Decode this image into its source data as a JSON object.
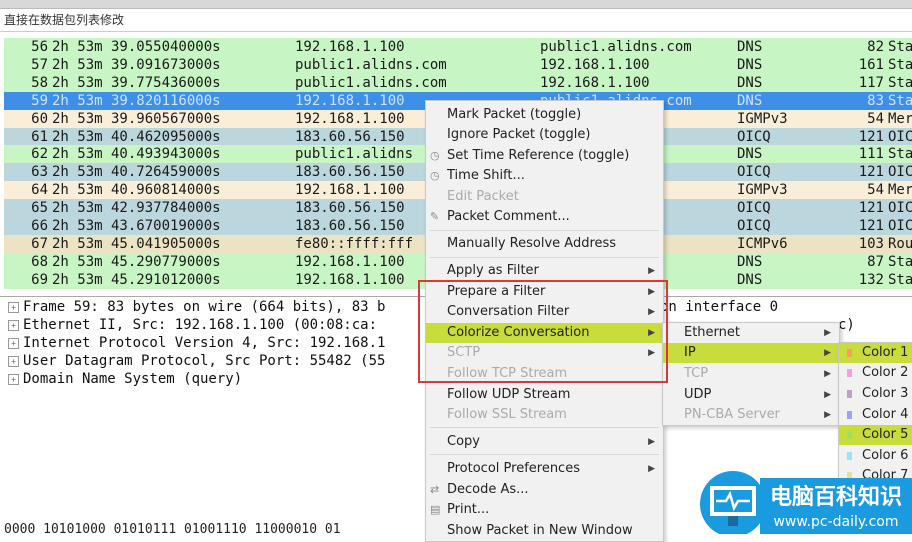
{
  "filter_bar": {
    "text": "直接在数据包列表修改"
  },
  "packets": [
    {
      "no": "56",
      "time": "2h 53m 39.055040000s",
      "src": "192.168.1.100",
      "dst": "public1.alidns.com",
      "proto": "DNS",
      "len": "82",
      "info": "Sta",
      "color": "#c8f5c4"
    },
    {
      "no": "57",
      "time": "2h 53m 39.091673000s",
      "src": "public1.alidns.com",
      "dst": "192.168.1.100",
      "proto": "DNS",
      "len": "161",
      "info": "Sta",
      "color": "#c8f5c4"
    },
    {
      "no": "58",
      "time": "2h 53m 39.775436000s",
      "src": "public1.alidns.com",
      "dst": "192.168.1.100",
      "proto": "DNS",
      "len": "117",
      "info": "Sta",
      "color": "#c8f5c4"
    },
    {
      "no": "59",
      "time": "2h 53m 39.820116000s",
      "src": "192.168.1.100",
      "dst": "public1.alidns.com",
      "proto": "DNS",
      "len": "83",
      "info": "Sta",
      "color": "#3d8fe8",
      "selected": true
    },
    {
      "no": "60",
      "time": "2h 53m 39.960567000s",
      "src": "192.168.1.100",
      "dst": "t",
      "proto": "IGMPv3",
      "len": "54",
      "info": "Mer",
      "color": "#fbeed8"
    },
    {
      "no": "61",
      "time": "2h 53m 40.462095000s",
      "src": "183.60.56.150",
      "dst": "",
      "proto": "OICQ",
      "len": "121",
      "info": "OIC",
      "color": "#bcd6de"
    },
    {
      "no": "62",
      "time": "2h 53m 40.493943000s",
      "src": "public1.alidns",
      "dst": "",
      "proto": "DNS",
      "len": "111",
      "info": "Sta",
      "color": "#c8f5c4"
    },
    {
      "no": "63",
      "time": "2h 53m 40.726459000s",
      "src": "183.60.56.150",
      "dst": "",
      "proto": "OICQ",
      "len": "121",
      "info": "OIC",
      "color": "#bcd6de"
    },
    {
      "no": "64",
      "time": "2h 53m 40.960814000s",
      "src": "192.168.1.100",
      "dst": "t",
      "proto": "IGMPv3",
      "len": "54",
      "info": "Mer",
      "color": "#fbeed8"
    },
    {
      "no": "65",
      "time": "2h 53m 42.937784000s",
      "src": "183.60.56.150",
      "dst": "",
      "proto": "OICQ",
      "len": "121",
      "info": "OIC",
      "color": "#bcd6de"
    },
    {
      "no": "66",
      "time": "2h 53m 43.670019000s",
      "src": "183.60.56.150",
      "dst": "",
      "proto": "OICQ",
      "len": "121",
      "info": "OIC",
      "color": "#bcd6de"
    },
    {
      "no": "67",
      "time": "2h 53m 45.041905000s",
      "src": "fe80::ffff:fff",
      "dst": "",
      "proto": "ICMPv6",
      "len": "103",
      "info": "Rou",
      "color": "#ece2c4"
    },
    {
      "no": "68",
      "time": "2h 53m 45.290779000s",
      "src": "192.168.1.100",
      "dst": "s.com",
      "proto": "DNS",
      "len": "87",
      "info": "Sta",
      "color": "#c8f5c4"
    },
    {
      "no": "69",
      "time": "2h 53m 45.291012000s",
      "src": "192.168.1.100",
      "dst": "s.com",
      "proto": "DNS",
      "len": "132",
      "info": "Sta",
      "color": "#c8f5c4"
    }
  ],
  "details": [
    {
      "text": "Frame 59: 83 bytes on wire (664 bits), 83 b",
      "tail": "on interface 0"
    },
    {
      "text": "Ethernet II, Src: 192.168.1.100 (00:08:ca:",
      "tail": "c)"
    },
    {
      "text": "Internet Protocol Version 4, Src: 192.168.1",
      "tail": ""
    },
    {
      "text": "User Datagram Protocol, Src Port: 55482 (55",
      "tail": ""
    },
    {
      "text": "Domain Name System (query)",
      "tail": ""
    }
  ],
  "hex_line": "0000  10101000 01010111 01001110 11000010 01",
  "context_menu": [
    {
      "label": "Mark Packet (toggle)"
    },
    {
      "label": "Ignore Packet (toggle)"
    },
    {
      "label": "Set Time Reference (toggle)",
      "icon": "clock-icon"
    },
    {
      "label": "Time Shift...",
      "icon": "clock-icon"
    },
    {
      "label": "Edit Packet",
      "disabled": true
    },
    {
      "label": "Packet Comment...",
      "icon": "comment-icon"
    },
    {
      "label": "Manually Resolve Address"
    },
    {
      "label": "Apply as Filter",
      "submenu": true
    },
    {
      "label": "Prepare a Filter",
      "submenu": true
    },
    {
      "label": "Conversation Filter",
      "submenu": true
    },
    {
      "label": "Colorize Conversation",
      "submenu": true,
      "highlighted": true
    },
    {
      "label": "SCTP",
      "submenu": true,
      "disabled": true
    },
    {
      "label": "Follow TCP Stream",
      "disabled": true
    },
    {
      "label": "Follow UDP Stream"
    },
    {
      "label": "Follow SSL Stream",
      "disabled": true
    },
    {
      "label": "Copy",
      "submenu": true
    },
    {
      "label": "Protocol Preferences",
      "submenu": true
    },
    {
      "label": "Decode As...",
      "icon": "decode-icon"
    },
    {
      "label": "Print...",
      "icon": "print-icon"
    },
    {
      "label": "Show Packet in New Window"
    }
  ],
  "colorize_submenu": [
    {
      "label": "Ethernet",
      "submenu": true
    },
    {
      "label": "IP",
      "submenu": true,
      "highlighted": true
    },
    {
      "label": "TCP",
      "submenu": true,
      "disabled": true
    },
    {
      "label": "UDP",
      "submenu": true
    },
    {
      "label": "PN-CBA Server",
      "submenu": true,
      "disabled": true
    }
  ],
  "color_submenu": [
    {
      "label": "Color 1",
      "swatch": "#f5a060",
      "highlighted": true
    },
    {
      "label": "Color 2",
      "swatch": "#f0a0e0"
    },
    {
      "label": "Color 3",
      "swatch": "#c0a0c0"
    },
    {
      "label": "Color 4",
      "swatch": "#a0a0f0"
    },
    {
      "label": "Color 5",
      "swatch": "#a0e060",
      "highlighted": true
    },
    {
      "label": "Color 6",
      "swatch": "#a0e0f0"
    },
    {
      "label": "Color 7",
      "swatch": "#e0e0a0"
    }
  ],
  "watermark": {
    "title": "电脑百科知识",
    "url": "www.pc-daily.com"
  },
  "colors": {
    "highlight": "#c8dc3c",
    "selected_row": "#3d8fe8",
    "annotation_box": "#d83a3a"
  }
}
